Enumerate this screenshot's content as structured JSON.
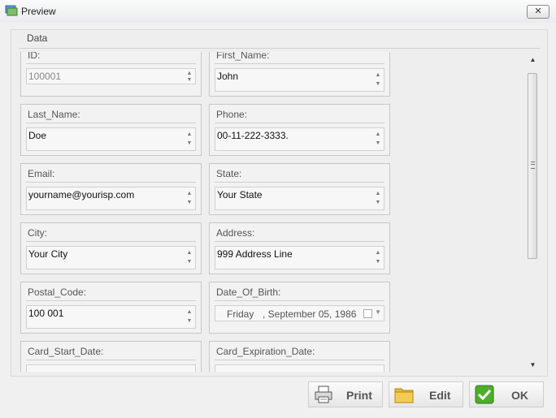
{
  "window": {
    "title": "Preview",
    "close_label": "✕"
  },
  "group": {
    "title": "Data"
  },
  "fields": [
    {
      "label": "ID:",
      "value": "100001"
    },
    {
      "label": "First_Name:",
      "value": "John"
    },
    {
      "label": "Last_Name:",
      "value": "Doe"
    },
    {
      "label": "Phone:",
      "value": "00-11-222-3333."
    },
    {
      "label": "Email:",
      "value": "yourname@yourisp.com"
    },
    {
      "label": "State:",
      "value": "Your State"
    },
    {
      "label": "City:",
      "value": "Your City"
    },
    {
      "label": "Address:",
      "value": "999 Address Line"
    },
    {
      "label": "Postal_Code:",
      "value": "100 001"
    },
    {
      "label": "Date_Of_Birth:",
      "day": "Friday",
      "rest": ", September 05, 1986"
    },
    {
      "label": "Card_Start_Date:"
    },
    {
      "label": "Card_Expiration_Date:"
    }
  ],
  "buttons": {
    "print": "Print",
    "edit": "Edit",
    "ok": "OK"
  },
  "scrollbar": {
    "up": "▲",
    "down": "▼"
  }
}
